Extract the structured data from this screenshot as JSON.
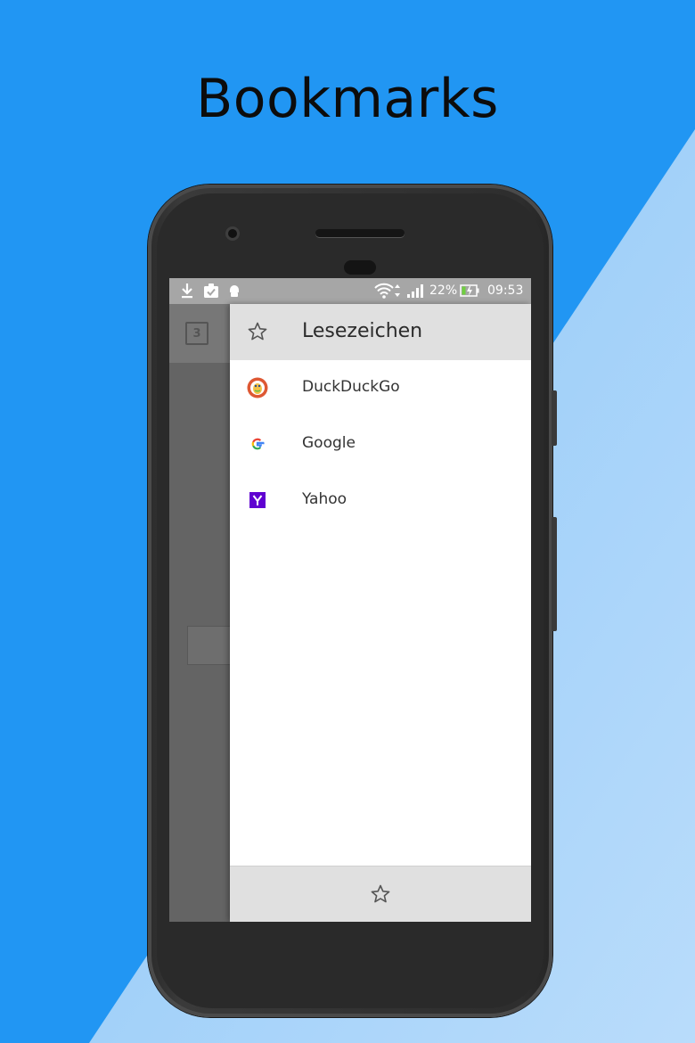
{
  "headline": "Bookmarks",
  "colors": {
    "background": "#2196f3",
    "diagonal": "#aad4fa",
    "drawer_header": "#e0e0e0"
  },
  "status_bar": {
    "battery": "22%",
    "time": "09:53",
    "icons": [
      "download-icon",
      "clipboard-check-icon",
      "android-icon",
      "wifi-icon",
      "signal-icon",
      "battery-icon"
    ]
  },
  "underlying_app": {
    "tab_count": "3"
  },
  "drawer": {
    "title": "Lesezeichen",
    "header_icon": "star-outline-icon",
    "bookmarks": [
      {
        "label": "DuckDuckGo",
        "icon": "duckduckgo-icon"
      },
      {
        "label": "Google",
        "icon": "google-icon"
      },
      {
        "label": "Yahoo",
        "icon": "yahoo-icon"
      }
    ],
    "footer_icon": "star-outline-icon"
  }
}
